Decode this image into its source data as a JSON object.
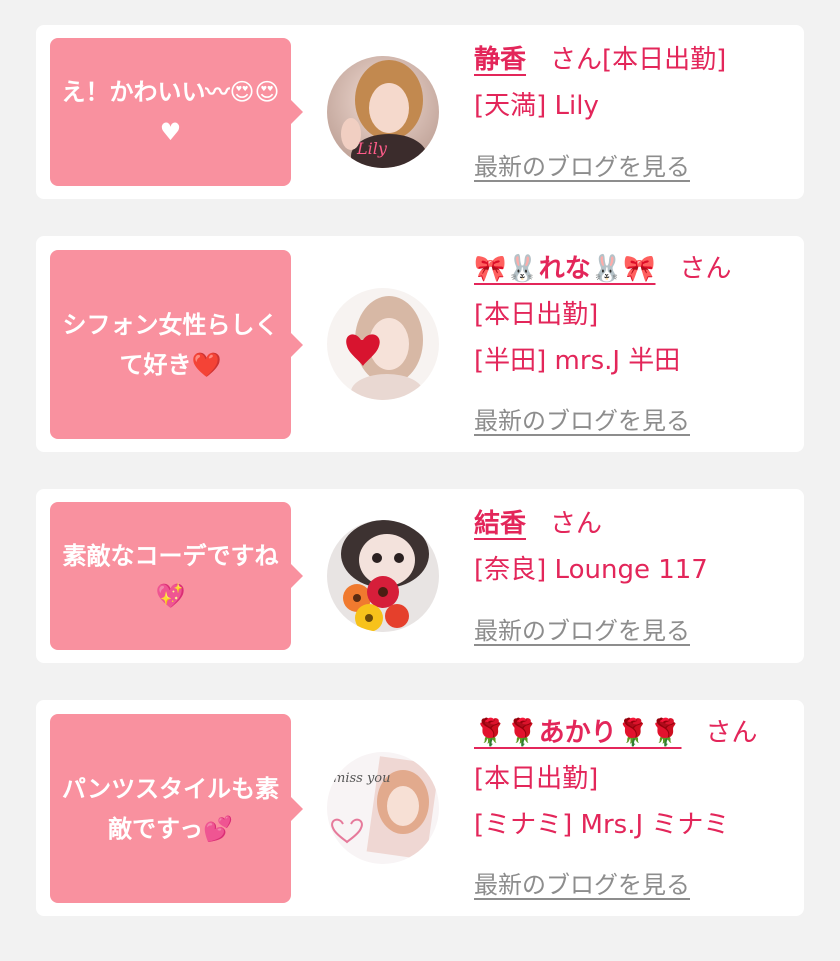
{
  "reviews": [
    {
      "comment": "え！かわいい〰😍😍♥",
      "cast_name": "静香",
      "honorific": "さん",
      "status": "[本日出勤]",
      "shop": "[天満] Lily",
      "blog_link": "最新のブログを見る",
      "avatar_caption": "Lily"
    },
    {
      "comment": "シフォン女性らしくて好き❤️",
      "cast_name": "🎀🐰れな🐰🎀",
      "honorific": "さん",
      "status": "[本日出勤]",
      "shop": "[半田] mrs.J 半田",
      "blog_link": "最新のブログを見る"
    },
    {
      "comment": "素敵なコーデですね💖",
      "cast_name": "結香",
      "honorific": "さん",
      "status": "",
      "shop": "[奈良] Lounge 117",
      "blog_link": "最新のブログを見る"
    },
    {
      "comment": "パンツスタイルも素敵ですっ💕",
      "cast_name": "🌹🌹あかり🌹🌹",
      "honorific": "さん",
      "status": "[本日出勤]",
      "shop": "[ミナミ] Mrs.J ミナミ",
      "blog_link": "最新のブログを見る",
      "avatar_caption": "miss you"
    }
  ],
  "colors": {
    "background": "#f2f2f2",
    "card": "#ffffff",
    "bubble": "#f9919f",
    "accent": "#e3265a",
    "link_gray": "#8d8d8d"
  }
}
